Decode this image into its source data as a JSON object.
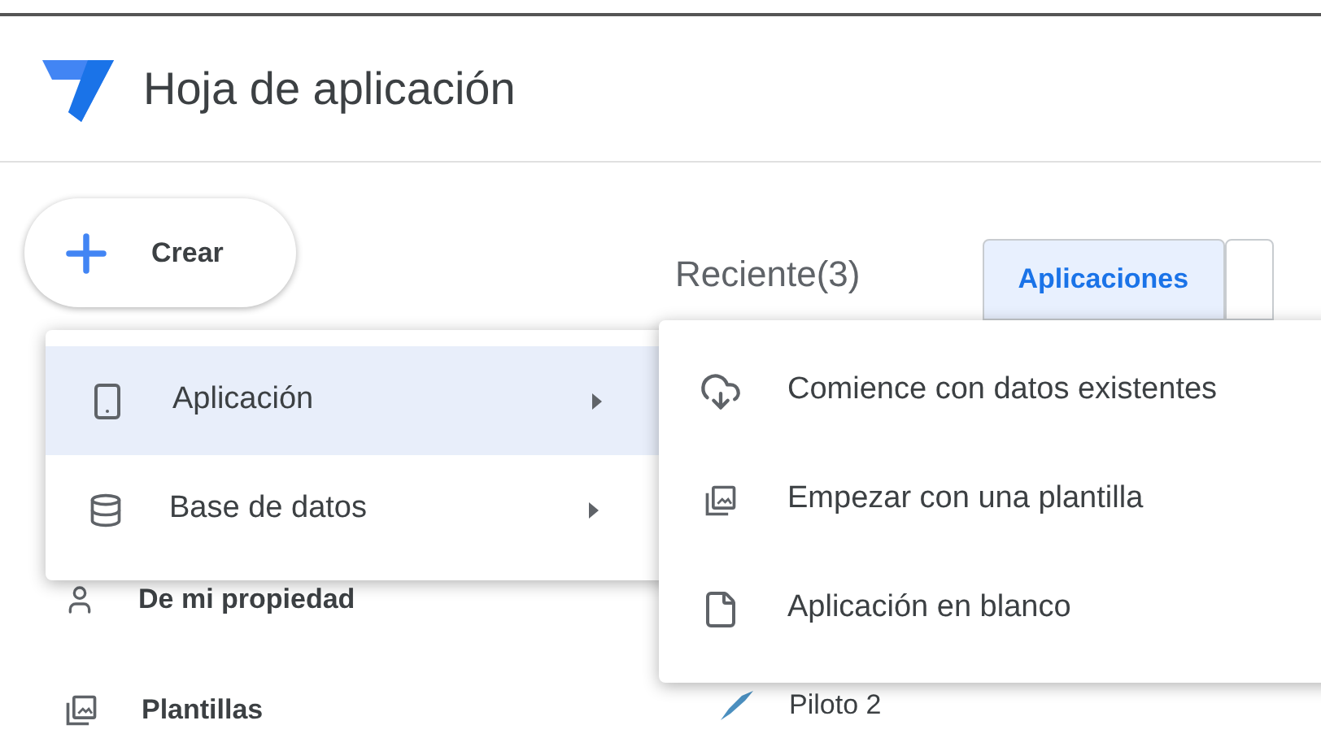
{
  "app": {
    "title": "Hoja de aplicación"
  },
  "create_button": {
    "label": "Crear"
  },
  "sidebar": {
    "items": [
      {
        "label": "De mi propiedad",
        "kind": "person"
      },
      {
        "label": "Plantillas",
        "kind": "gallery"
      }
    ]
  },
  "recent": {
    "label": "Reciente(3)"
  },
  "tabs": [
    {
      "label": "Aplicaciones",
      "selected": true
    }
  ],
  "apps": [
    {
      "name": "Piloto 2"
    }
  ],
  "create_menu": {
    "items": [
      {
        "label": "Aplicación",
        "kind": "phone",
        "selected": true
      },
      {
        "label": "Base de datos",
        "kind": "database",
        "selected": false
      }
    ]
  },
  "submenu": {
    "items": [
      {
        "label": "Comience con datos existentes",
        "kind": "cloud"
      },
      {
        "label": "Empezar con una plantilla",
        "kind": "gallery"
      },
      {
        "label": "Aplicación en blanco",
        "kind": "file"
      }
    ]
  }
}
